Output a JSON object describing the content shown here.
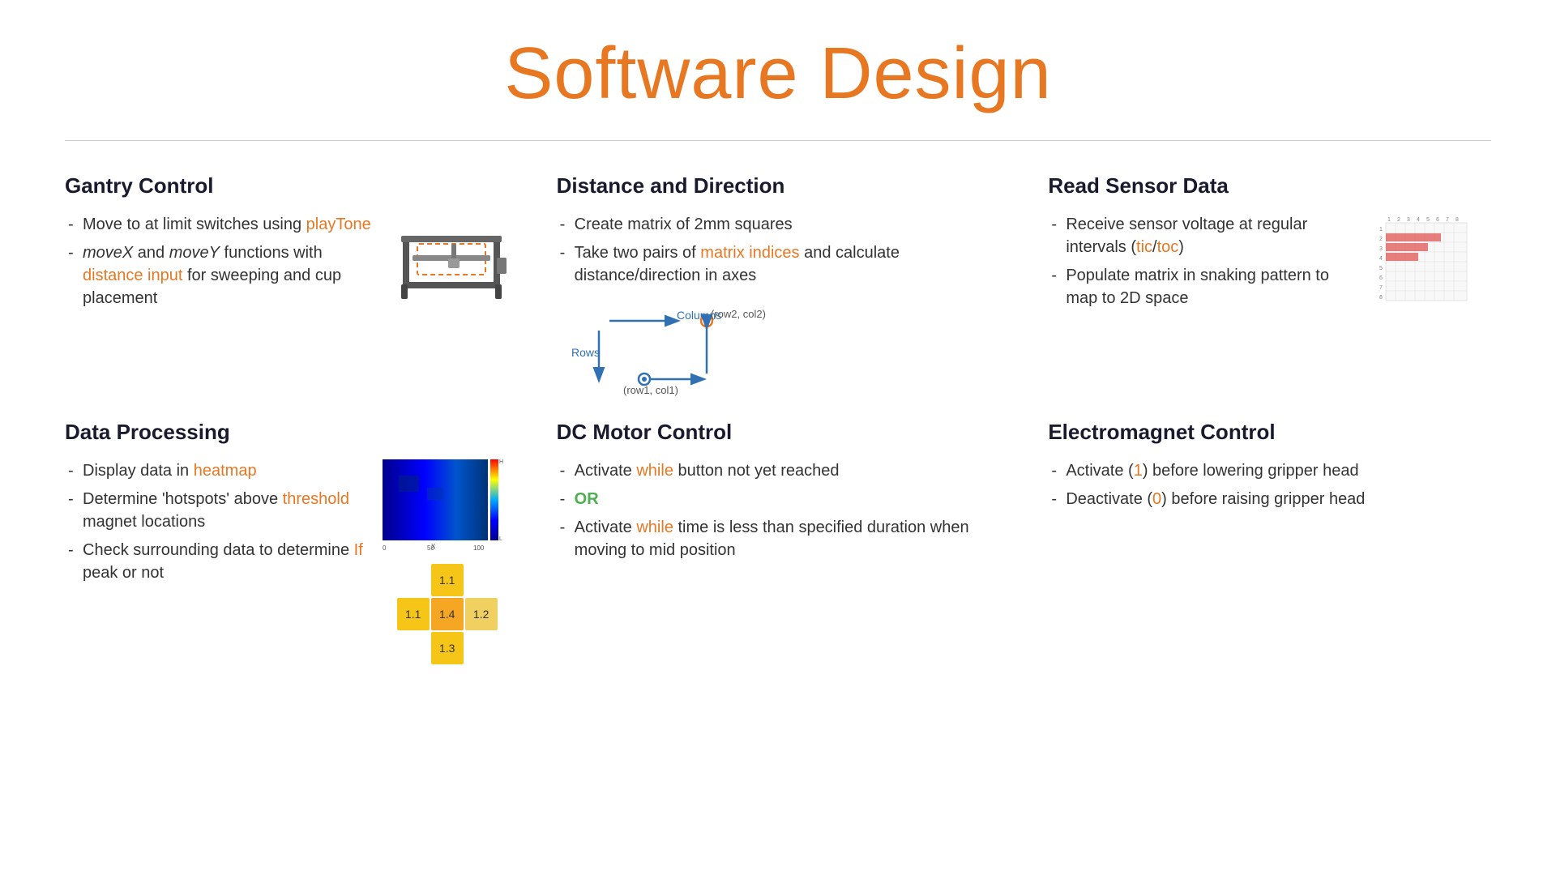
{
  "title": "Software Design",
  "sections": {
    "gantry": {
      "heading": "Gantry Control",
      "bullets": [
        {
          "text": "Move to at limit switches using ",
          "highlight": "playTone",
          "rest": ""
        },
        {
          "italic": "moveX",
          "text2": " and ",
          "italic2": "moveY",
          "text3": " functions with ",
          "highlight": "distance input",
          "rest": " for sweeping and cup placement"
        }
      ]
    },
    "distance": {
      "heading": "Distance and Direction",
      "bullet1": "Create matrix of 2mm squares",
      "bullet2_pre": "Take two pairs of ",
      "bullet2_highlight": "matrix indices",
      "bullet2_post": " and calculate distance/direction in axes",
      "label_rows": "Rows",
      "label_cols": "Columns",
      "label_p1": "(row1, col1)",
      "label_p2": "(row2, col2)"
    },
    "sensor": {
      "heading": "Read Sensor Data",
      "bullet1_pre": "Receive sensor voltage at regular intervals (",
      "bullet1_tic": "tic",
      "bullet1_slash": "/",
      "bullet1_toc": "toc",
      "bullet1_post": ")",
      "bullet2_pre": "Populate matrix in snaking pattern to map to 2D space"
    },
    "dataproc": {
      "heading": "Data Processing",
      "bullet1_pre": "Display data in ",
      "bullet1_highlight": "heatmap",
      "bullet2": "Determine 'hotspots' above ",
      "bullet2_highlight": "threshold",
      "bullet2_post": " magnet locations",
      "bullet3_pre": "Check surrounding data to determine ",
      "bullet3_highlight": "If",
      "bullet3_post": " peak or not"
    },
    "dcmotor": {
      "heading": "DC Motor Control",
      "bullet1_pre": "Activate ",
      "bullet1_highlight": "while",
      "bullet1_post": " button not yet reached",
      "bullet2": "OR",
      "bullet3_pre": "Activate ",
      "bullet3_highlight": "while",
      "bullet3_post": " time is less than specified duration when moving to mid position"
    },
    "electromagnet": {
      "heading": "Electromagnet Control",
      "bullet1_pre": "Activate (",
      "bullet1_highlight": "1",
      "bullet1_post": ") before lowering gripper head",
      "bullet2_pre": "Deactivate (",
      "bullet2_highlight": "0",
      "bullet2_post": ") before raising gripper head"
    }
  },
  "peak_cells": [
    {
      "val": "",
      "style": "empty"
    },
    {
      "val": "1.1",
      "style": "yellow"
    },
    {
      "val": "",
      "style": "empty"
    },
    {
      "val": "1.1",
      "style": "orange-lt"
    },
    {
      "val": "1.4",
      "style": "orange-lt"
    },
    {
      "val": "1.2",
      "style": "yellow2"
    },
    {
      "val": "",
      "style": "empty"
    },
    {
      "val": "1.3",
      "style": "yellow"
    },
    {
      "val": "",
      "style": "empty"
    }
  ],
  "sensor_grid_cols": [
    "1",
    "2",
    "3",
    "4",
    "5",
    "6",
    "7",
    "8"
  ],
  "sensor_rows": 8
}
